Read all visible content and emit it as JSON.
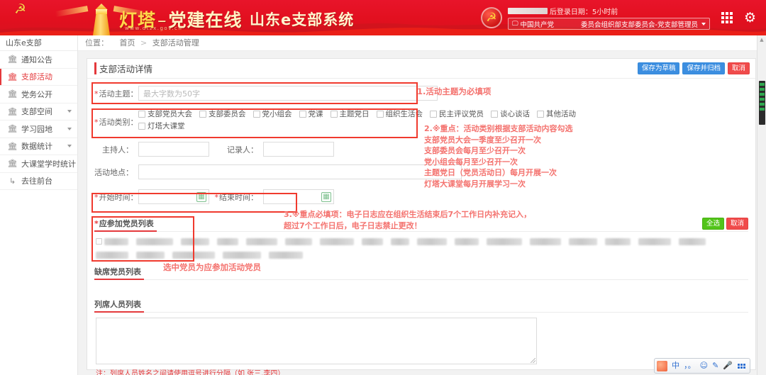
{
  "header": {
    "brand_name": "灯塔",
    "brand_dash": "–",
    "brand_sub": "党建在线",
    "brand_url": "www.dtzx.gov.cn",
    "system_title": "山东e支部系统",
    "emblem_icon": "party-emblem-icon",
    "user_login_text": "后登录日期：5小时前",
    "org_select_value": "中国共产党　　　　委员会组织部支部委员会-党支部管理员",
    "apps_icon": "grid-apps-icon",
    "settings_icon": "gear-icon"
  },
  "sidebar": {
    "title": "山东e支部",
    "items": [
      {
        "label": "通知公告",
        "icon": "building-icon",
        "has_caret": false,
        "active": false
      },
      {
        "label": "支部活动",
        "icon": "building-icon",
        "has_caret": false,
        "active": true
      },
      {
        "label": "党务公开",
        "icon": "building-icon",
        "has_caret": false,
        "active": false
      },
      {
        "label": "支部空间",
        "icon": "building-icon",
        "has_caret": true,
        "active": false
      },
      {
        "label": "学习园地",
        "icon": "building-icon",
        "has_caret": true,
        "active": false
      },
      {
        "label": "数据统计",
        "icon": "building-icon",
        "has_caret": true,
        "active": false
      },
      {
        "label": "大课堂学时统计",
        "icon": "building-icon",
        "has_caret": false,
        "active": false
      },
      {
        "label": "去往前台",
        "icon": "arrow-exit-icon",
        "has_caret": false,
        "active": false
      }
    ]
  },
  "breadcrumb": {
    "label": "位置：",
    "home": "首页",
    "separator": ">",
    "current": "支部活动管理"
  },
  "panel": {
    "title": "支部活动详情",
    "buttons": {
      "save_draft": "保存为草稿",
      "save_archive": "保存并归档",
      "cancel": "取消"
    }
  },
  "form": {
    "topic": {
      "label": "活动主题：",
      "required": true,
      "value": "",
      "placeholder": "最大字数为50字"
    },
    "category": {
      "label": "活动类别：",
      "required": true,
      "options_row1": [
        "支部党员大会",
        "支部委员会",
        "党小组会",
        "党课",
        "主题党日",
        "组织生活会",
        "民主评议党员",
        "谈心谈话",
        "其他活动"
      ],
      "options_row2": [
        "灯塔大课堂"
      ]
    },
    "host": {
      "label": "主持人：",
      "value": "",
      "required": false
    },
    "recorder": {
      "label": "记录人：",
      "value": "",
      "required": false
    },
    "place": {
      "label": "活动地点：",
      "value": "",
      "required": false
    },
    "start_time": {
      "label": "开始时间：",
      "value": "",
      "required": true,
      "icon": "calendar-icon"
    },
    "end_time": {
      "label": "结束时间：",
      "value": "",
      "required": true,
      "icon": "calendar-icon"
    }
  },
  "sections": {
    "attendees": {
      "title": "应参加党员列表",
      "required": true,
      "select_all": "全选",
      "cancel": "取消",
      "members_row1_widths": [
        34,
        52,
        40,
        30,
        44,
        38,
        48,
        30,
        26,
        42,
        34,
        50,
        44,
        40,
        36,
        46,
        38
      ],
      "members_row2_widths": [
        46,
        40,
        60,
        54,
        48
      ]
    },
    "absentees": {
      "title": "缺席党员列表"
    },
    "observers": {
      "title": "列席人员列表",
      "value": "",
      "note": "注：列席人员姓名之间请使用逗号进行分隔（如 张三,李四）"
    }
  },
  "annotations": {
    "a1": "1.活动主题为必填项",
    "a2": "2.※重点：活动类别根据支部活动内容勾选\n支部党员大会一季度至少召开一次\n支部委员会每月至少召开一次\n党小组会每月至少召开一次\n主题党日（党员活动日）每月开展一次\n灯塔大课堂每月开展学习一次",
    "a3": "3.※重点必填项：电子日志应在组织生活结束后7个工作日内补充记入，\n超过7个工作日后，电子日志禁止更改！",
    "a4": "选中党员为应参加活动党员"
  },
  "ime": {
    "logo": "sogou-ime-logo-icon",
    "mode": "中",
    "punctuation": "，。",
    "emoji_icon": "smiley-icon",
    "pen_icon": "pen-icon",
    "mic_icon": "microphone-icon",
    "keyboard_icon": "keyboard-icon"
  },
  "colors": {
    "brand_red": "#e4393c",
    "header_red": "#e2101f",
    "gold": "#ffd74a",
    "annotation_red": "#f4736f",
    "highlight_box": "#f03a2e",
    "blue_button": "#3c8ee0",
    "green_button": "#52c41a"
  }
}
